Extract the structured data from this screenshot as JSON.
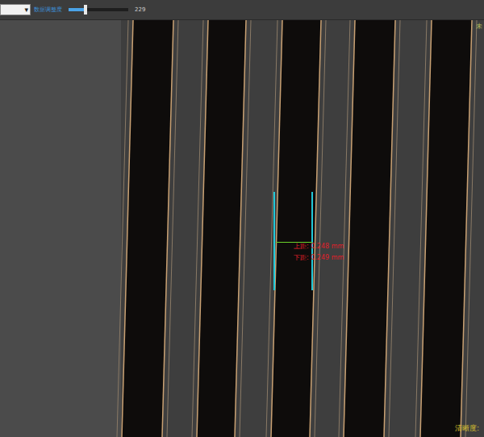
{
  "toolbar": {
    "dropdown": {
      "arrow": "▾"
    },
    "slider": {
      "label": "数据调整度",
      "level": 0.28,
      "reading": "229"
    }
  },
  "image": {
    "corner_label": "未",
    "focus_label": "清晰度:"
  },
  "measurement": {
    "lines": [
      "上距: 0.248 mm",
      "下距: 0.249 mm"
    ]
  }
}
